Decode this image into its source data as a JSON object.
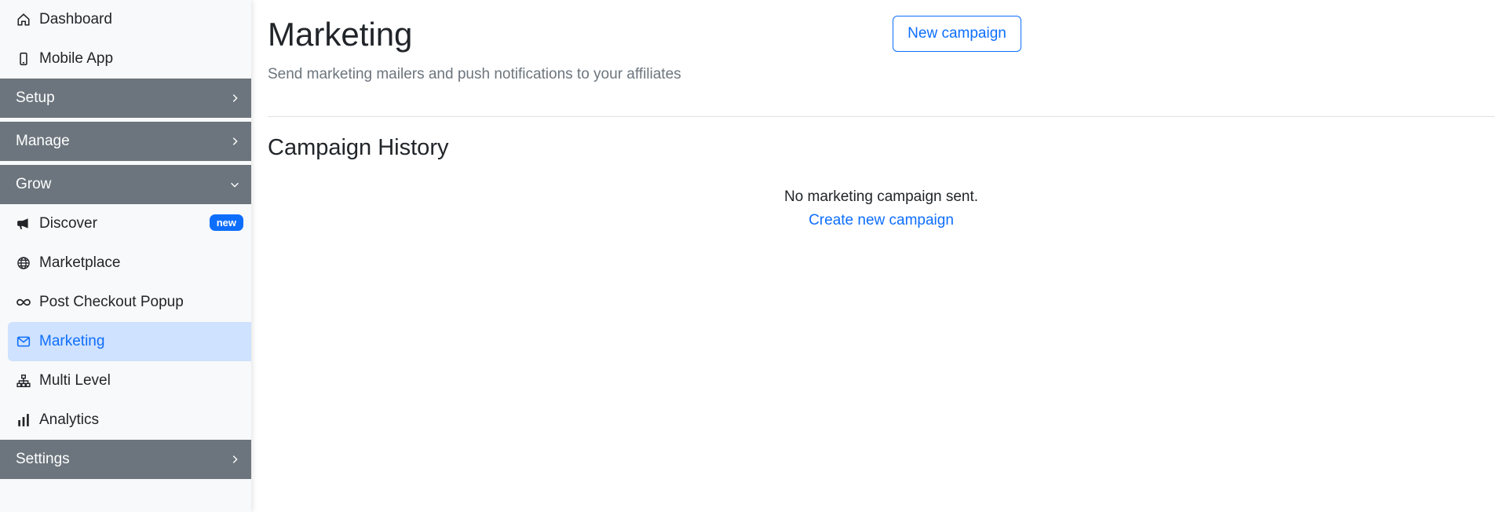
{
  "sidebar": {
    "top_items": [
      {
        "label": "Dashboard",
        "icon": "house-icon"
      },
      {
        "label": "Mobile App",
        "icon": "phone-icon"
      }
    ],
    "sections": {
      "setup": "Setup",
      "manage": "Manage",
      "grow": "Grow",
      "settings": "Settings"
    },
    "grow_items": [
      {
        "label": "Discover",
        "icon": "megaphone-icon",
        "badge": "new"
      },
      {
        "label": "Marketplace",
        "icon": "globe-icon"
      },
      {
        "label": "Post Checkout Popup",
        "icon": "infinity-icon"
      },
      {
        "label": "Marketing",
        "icon": "envelope-icon",
        "active": true
      },
      {
        "label": "Multi Level",
        "icon": "diagram-icon"
      },
      {
        "label": "Analytics",
        "icon": "bar-chart-icon"
      }
    ]
  },
  "main": {
    "title": "Marketing",
    "subtitle": "Send marketing mailers and push notifications to your affiliates",
    "new_campaign_label": "New campaign",
    "history_title": "Campaign History",
    "empty_text": "No marketing campaign sent.",
    "create_link": "Create new campaign"
  },
  "colors": {
    "accent": "#0d6efd",
    "section_bg": "#6c757d",
    "active_bg": "#cfe2ff",
    "sidebar_bg": "#f8f9fa"
  }
}
